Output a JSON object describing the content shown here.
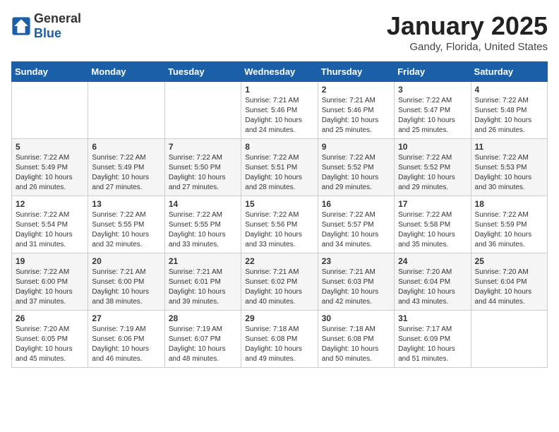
{
  "header": {
    "logo_general": "General",
    "logo_blue": "Blue",
    "month": "January 2025",
    "location": "Gandy, Florida, United States"
  },
  "weekdays": [
    "Sunday",
    "Monday",
    "Tuesday",
    "Wednesday",
    "Thursday",
    "Friday",
    "Saturday"
  ],
  "weeks": [
    [
      {
        "day": "",
        "info": ""
      },
      {
        "day": "",
        "info": ""
      },
      {
        "day": "",
        "info": ""
      },
      {
        "day": "1",
        "info": "Sunrise: 7:21 AM\nSunset: 5:46 PM\nDaylight: 10 hours\nand 24 minutes."
      },
      {
        "day": "2",
        "info": "Sunrise: 7:21 AM\nSunset: 5:46 PM\nDaylight: 10 hours\nand 25 minutes."
      },
      {
        "day": "3",
        "info": "Sunrise: 7:22 AM\nSunset: 5:47 PM\nDaylight: 10 hours\nand 25 minutes."
      },
      {
        "day": "4",
        "info": "Sunrise: 7:22 AM\nSunset: 5:48 PM\nDaylight: 10 hours\nand 26 minutes."
      }
    ],
    [
      {
        "day": "5",
        "info": "Sunrise: 7:22 AM\nSunset: 5:49 PM\nDaylight: 10 hours\nand 26 minutes."
      },
      {
        "day": "6",
        "info": "Sunrise: 7:22 AM\nSunset: 5:49 PM\nDaylight: 10 hours\nand 27 minutes."
      },
      {
        "day": "7",
        "info": "Sunrise: 7:22 AM\nSunset: 5:50 PM\nDaylight: 10 hours\nand 27 minutes."
      },
      {
        "day": "8",
        "info": "Sunrise: 7:22 AM\nSunset: 5:51 PM\nDaylight: 10 hours\nand 28 minutes."
      },
      {
        "day": "9",
        "info": "Sunrise: 7:22 AM\nSunset: 5:52 PM\nDaylight: 10 hours\nand 29 minutes."
      },
      {
        "day": "10",
        "info": "Sunrise: 7:22 AM\nSunset: 5:52 PM\nDaylight: 10 hours\nand 29 minutes."
      },
      {
        "day": "11",
        "info": "Sunrise: 7:22 AM\nSunset: 5:53 PM\nDaylight: 10 hours\nand 30 minutes."
      }
    ],
    [
      {
        "day": "12",
        "info": "Sunrise: 7:22 AM\nSunset: 5:54 PM\nDaylight: 10 hours\nand 31 minutes."
      },
      {
        "day": "13",
        "info": "Sunrise: 7:22 AM\nSunset: 5:55 PM\nDaylight: 10 hours\nand 32 minutes."
      },
      {
        "day": "14",
        "info": "Sunrise: 7:22 AM\nSunset: 5:55 PM\nDaylight: 10 hours\nand 33 minutes."
      },
      {
        "day": "15",
        "info": "Sunrise: 7:22 AM\nSunset: 5:56 PM\nDaylight: 10 hours\nand 33 minutes."
      },
      {
        "day": "16",
        "info": "Sunrise: 7:22 AM\nSunset: 5:57 PM\nDaylight: 10 hours\nand 34 minutes."
      },
      {
        "day": "17",
        "info": "Sunrise: 7:22 AM\nSunset: 5:58 PM\nDaylight: 10 hours\nand 35 minutes."
      },
      {
        "day": "18",
        "info": "Sunrise: 7:22 AM\nSunset: 5:59 PM\nDaylight: 10 hours\nand 36 minutes."
      }
    ],
    [
      {
        "day": "19",
        "info": "Sunrise: 7:22 AM\nSunset: 6:00 PM\nDaylight: 10 hours\nand 37 minutes."
      },
      {
        "day": "20",
        "info": "Sunrise: 7:21 AM\nSunset: 6:00 PM\nDaylight: 10 hours\nand 38 minutes."
      },
      {
        "day": "21",
        "info": "Sunrise: 7:21 AM\nSunset: 6:01 PM\nDaylight: 10 hours\nand 39 minutes."
      },
      {
        "day": "22",
        "info": "Sunrise: 7:21 AM\nSunset: 6:02 PM\nDaylight: 10 hours\nand 40 minutes."
      },
      {
        "day": "23",
        "info": "Sunrise: 7:21 AM\nSunset: 6:03 PM\nDaylight: 10 hours\nand 42 minutes."
      },
      {
        "day": "24",
        "info": "Sunrise: 7:20 AM\nSunset: 6:04 PM\nDaylight: 10 hours\nand 43 minutes."
      },
      {
        "day": "25",
        "info": "Sunrise: 7:20 AM\nSunset: 6:04 PM\nDaylight: 10 hours\nand 44 minutes."
      }
    ],
    [
      {
        "day": "26",
        "info": "Sunrise: 7:20 AM\nSunset: 6:05 PM\nDaylight: 10 hours\nand 45 minutes."
      },
      {
        "day": "27",
        "info": "Sunrise: 7:19 AM\nSunset: 6:06 PM\nDaylight: 10 hours\nand 46 minutes."
      },
      {
        "day": "28",
        "info": "Sunrise: 7:19 AM\nSunset: 6:07 PM\nDaylight: 10 hours\nand 48 minutes."
      },
      {
        "day": "29",
        "info": "Sunrise: 7:18 AM\nSunset: 6:08 PM\nDaylight: 10 hours\nand 49 minutes."
      },
      {
        "day": "30",
        "info": "Sunrise: 7:18 AM\nSunset: 6:08 PM\nDaylight: 10 hours\nand 50 minutes."
      },
      {
        "day": "31",
        "info": "Sunrise: 7:17 AM\nSunset: 6:09 PM\nDaylight: 10 hours\nand 51 minutes."
      },
      {
        "day": "",
        "info": ""
      }
    ]
  ]
}
